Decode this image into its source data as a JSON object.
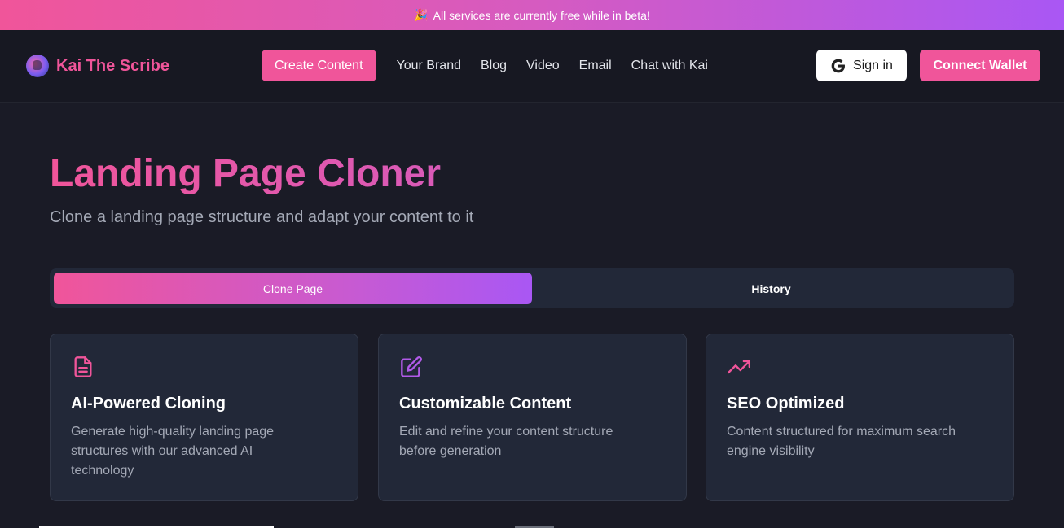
{
  "banner": {
    "icon": "party-popper-icon",
    "icon_glyph": "🎉",
    "text": "All services are currently free while in beta!"
  },
  "nav": {
    "brand": "Kai The Scribe",
    "create_label": "Create Content",
    "links": [
      "Your Brand",
      "Blog",
      "Video",
      "Email",
      "Chat with Kai"
    ],
    "signin_label": "Sign in",
    "wallet_label": "Connect Wallet"
  },
  "hero": {
    "title": "Landing Page Cloner",
    "subtitle": "Clone a landing page structure and adapt your content to it"
  },
  "tabs": [
    {
      "label": "Clone Page",
      "active": true
    },
    {
      "label": "History",
      "active": false
    }
  ],
  "features": [
    {
      "icon": "document-icon",
      "title": "AI-Powered Cloning",
      "desc": "Generate high-quality landing page structures with our advanced AI technology"
    },
    {
      "icon": "edit-icon",
      "title": "Customizable Content",
      "desc": "Edit and refine your content structure before generation"
    },
    {
      "icon": "trending-up-icon",
      "title": "SEO Optimized",
      "desc": "Content structured for maximum search engine visibility"
    }
  ],
  "colors": {
    "accent_pink": "#f0559a",
    "accent_purple": "#a957f4",
    "background": "#1a1b26",
    "card": "#222838"
  }
}
